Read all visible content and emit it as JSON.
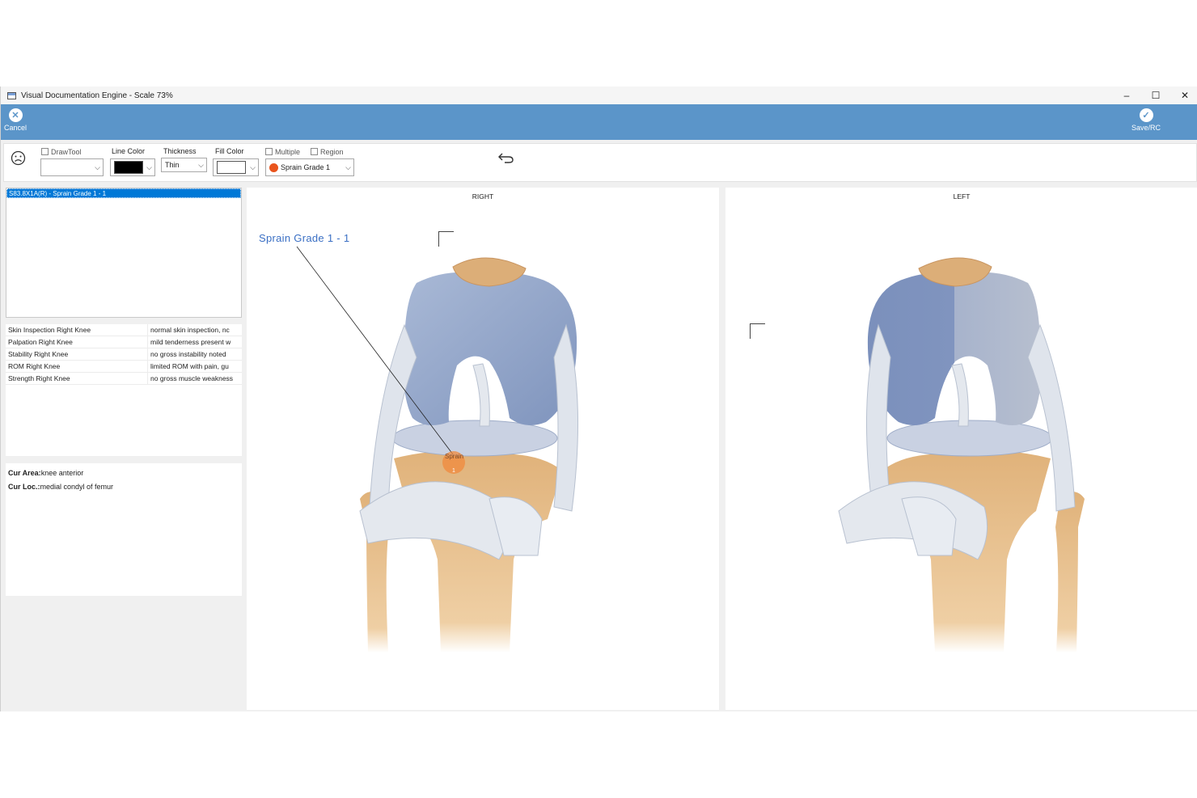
{
  "window": {
    "title": "Visual Documentation Engine - Scale 73%",
    "minimize": "–",
    "maximize": "☐",
    "close": "✕"
  },
  "ribbon": {
    "cancel_label": "Cancel",
    "save_label": "Save/RC"
  },
  "toolbar": {
    "drawtool_label": "DrawTool",
    "line_color_label": "Line Color",
    "thickness_label": "Thickness",
    "thickness_value": "Thin",
    "fill_color_label": "Fill Color",
    "multiple_label": "Multiple",
    "region_label": "Region",
    "annotation_value": "Sprain Grade 1",
    "line_color": "#000000",
    "fill_color": "#ffffff"
  },
  "annotations_list": {
    "selected_item": "S83.8X1A(R) - Sprain Grade 1 - 1"
  },
  "findings": [
    {
      "name": "Skin Inspection Right Knee",
      "value": "normal skin inspection, nc"
    },
    {
      "name": "Palpation Right Knee",
      "value": "mild tenderness present w"
    },
    {
      "name": "Stability Right Knee",
      "value": "no gross instability noted"
    },
    {
      "name": "ROM Right Knee",
      "value": "limited ROM with pain, gu"
    },
    {
      "name": "Strength Right Knee",
      "value": "no gross muscle weakness"
    }
  ],
  "current": {
    "area_label": "Cur Area:",
    "area_value": "knee anterior",
    "loc_label": "Cur Loc.:",
    "loc_value": "medial condyl of femur"
  },
  "panels": {
    "right_title": "RIGHT",
    "left_title": "LEFT",
    "annotation_label": "Sprain Grade 1  - 1",
    "marker_text": "Sprain",
    "marker_number": "1",
    "marker_color": "#f08a3c"
  }
}
